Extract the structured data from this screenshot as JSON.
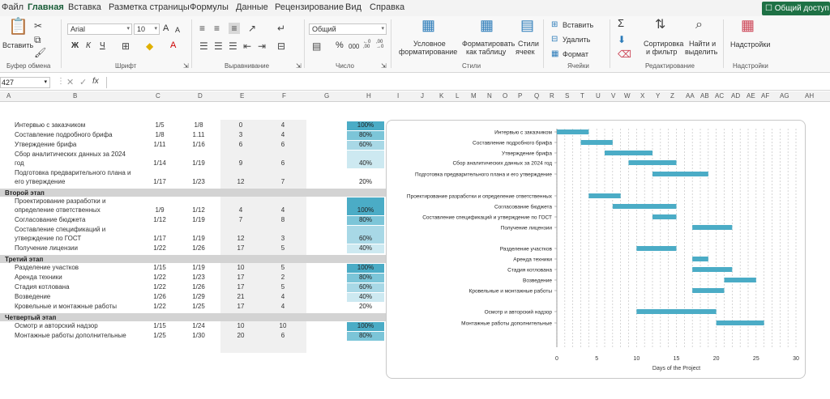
{
  "menu": {
    "tabs": [
      "Файл",
      "Главная",
      "Вставка",
      "Разметка страницы",
      "Формулы",
      "Данные",
      "Рецензирование",
      "Вид",
      "Справка"
    ],
    "active": "Главная",
    "share": "Общий доступ"
  },
  "ribbon": {
    "paste": "Вставить",
    "clipboard": "Буфер обмена",
    "font_name": "Arial",
    "font_size": "10",
    "font_group": "Шрифт",
    "align_group": "Выравнивание",
    "number_format": "Общий",
    "number_group": "Число",
    "conditional": [
      "Условное",
      "форматирование"
    ],
    "format_table": [
      "Форматировать",
      "как таблицу"
    ],
    "cell_styles": [
      "Стили",
      "ячеек"
    ],
    "styles_group": "Стили",
    "insert": "Вставить",
    "delete": "Удалить",
    "format": "Формат",
    "cells_group": "Ячейки",
    "sort": [
      "Сортировка",
      "и фильтр"
    ],
    "find": [
      "Найти и",
      "выделить"
    ],
    "editing_group": "Редактирование",
    "addins": "Надстройки",
    "addins_group": "Надстройки",
    "bold": "Ж",
    "italic": "К",
    "underline": "Ч",
    "font_grow": "A",
    "font_shrink": "A",
    "font_color": "A",
    "percent": "%",
    "thousands": "000",
    "dec_more": "←0 ,00",
    "dec_less": ",00 →0",
    "sum": "Σ"
  },
  "formula_bar": {
    "name_box": "427",
    "fx": "fx"
  },
  "columns": [
    "A",
    "B",
    "C",
    "D",
    "E",
    "F",
    "G",
    "H",
    "I",
    "J",
    "K",
    "L",
    "M",
    "N",
    "O",
    "P",
    "Q",
    "R",
    "S",
    "T",
    "U",
    "V",
    "W",
    "X",
    "Y",
    "Z",
    "AA",
    "AB",
    "AC",
    "AD",
    "AE",
    "AF",
    "AG",
    "AH"
  ],
  "rows": [
    {
      "task": [
        "Интервью с заказчиком"
      ],
      "start": "1/5",
      "end": "1/8",
      "e": "0",
      "f": "4",
      "pct": "100%"
    },
    {
      "task": [
        "Составление подробного брифа"
      ],
      "start": "1/8",
      "end": "1.11",
      "e": "3",
      "f": "4",
      "pct": "80%"
    },
    {
      "task": [
        "Утверждение брифа"
      ],
      "start": "1/11",
      "end": "1/16",
      "e": "6",
      "f": "6",
      "pct": "60%"
    },
    {
      "task": [
        "Сбор аналитических данных за 2024",
        "год"
      ],
      "start": "1/14",
      "end": "1/19",
      "e": "9",
      "f": "6",
      "pct": "40%"
    },
    {
      "task": [
        "Подготовка предварительного плана и",
        "его утверждение"
      ],
      "start": "1/17",
      "end": "1/23",
      "e": "12",
      "f": "7",
      "pct": "20%"
    },
    {
      "band": "Второй этап"
    },
    {
      "task": [
        "Проектирование разработки и",
        "определение ответственных"
      ],
      "start": "1/9",
      "end": "1/12",
      "e": "4",
      "f": "4",
      "pct": "100%"
    },
    {
      "task": [
        "Согласование бюджета"
      ],
      "start": "1/12",
      "end": "1/19",
      "e": "7",
      "f": "8",
      "pct": "80%"
    },
    {
      "task": [
        "Составление спецификаций и",
        "утверждение по ГОСТ"
      ],
      "start": "1/17",
      "end": "1/19",
      "e": "12",
      "f": "3",
      "pct": "60%"
    },
    {
      "task": [
        "Получение лицензии"
      ],
      "start": "1/22",
      "end": "1/26",
      "e": "17",
      "f": "5",
      "pct": "40%"
    },
    {
      "band": "Третий этап"
    },
    {
      "task": [
        "Разделение участков"
      ],
      "start": "1/15",
      "end": "1/19",
      "e": "10",
      "f": "5",
      "pct": "100%"
    },
    {
      "task": [
        "Аренда техники"
      ],
      "start": "1/22",
      "end": "1/23",
      "e": "17",
      "f": "2",
      "pct": "80%"
    },
    {
      "task": [
        "Стадия котлована"
      ],
      "start": "1/22",
      "end": "1/26",
      "e": "17",
      "f": "5",
      "pct": "60%"
    },
    {
      "task": [
        "Возведение"
      ],
      "start": "1/26",
      "end": "1/29",
      "e": "21",
      "f": "4",
      "pct": "40%"
    },
    {
      "task": [
        "Кровельные и монтажные работы"
      ],
      "start": "1/22",
      "end": "1/25",
      "e": "17",
      "f": "4",
      "pct": "20%"
    },
    {
      "band": "Четвертый этап"
    },
    {
      "task": [
        "Осмотр и авторский надзор"
      ],
      "start": "1/15",
      "end": "1/24",
      "e": "10",
      "f": "10",
      "pct": "100%"
    },
    {
      "task": [
        "Монтажные работы дополнительные"
      ],
      "start": "1/25",
      "end": "1/30",
      "e": "20",
      "f": "6",
      "pct": "80%"
    }
  ],
  "pct_colors": {
    "100%": "#4bacc6",
    "80%": "#7cc5d8",
    "60%": "#a8d8e6",
    "40%": "#cde9f1",
    "20%": "#ffffff"
  },
  "chart_data": {
    "type": "bar",
    "orientation": "horizontal-gantt",
    "categories": [
      "Интервью с заказчиком",
      "Составление подробного брифа",
      "Утверждение брифа",
      "Сбор аналитических данных за 2024 год",
      "Подготовка предварительного плана и его утверждение",
      "",
      "Проектирование разработки и определение ответственных",
      "Согласование бюджета",
      "Составление спецификаций и утверждение по ГОСТ",
      "Получение лицензии",
      "",
      "Разделение участков",
      "Аренда техники",
      "Стадия котлована",
      "Возведение",
      "Кровельные и монтажные работы",
      "",
      "Осмотр и авторский надзор",
      "Монтажные работы дополнительные"
    ],
    "start": [
      0,
      3,
      6,
      9,
      12,
      null,
      4,
      7,
      12,
      17,
      null,
      10,
      17,
      17,
      21,
      17,
      null,
      10,
      20
    ],
    "duration": [
      4,
      4,
      6,
      6,
      7,
      null,
      4,
      8,
      3,
      5,
      null,
      5,
      2,
      5,
      4,
      4,
      null,
      10,
      6
    ],
    "xlabel": "Days of the Project",
    "xlim": [
      0,
      30
    ],
    "xticks": [
      0,
      5,
      10,
      15,
      20,
      25,
      30
    ],
    "bar_color": "#4bacc6",
    "grid": "vertical-dashed"
  }
}
